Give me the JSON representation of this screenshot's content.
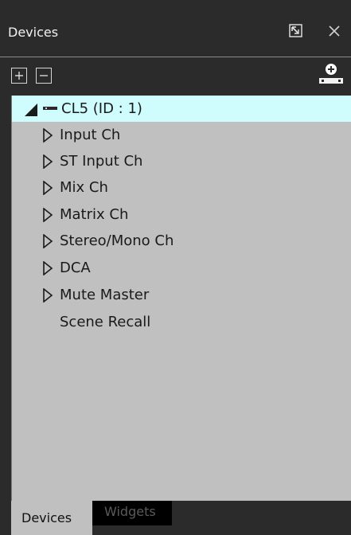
{
  "window": {
    "title": "Devices",
    "restore_icon": "restore-window-icon",
    "close_icon": "close-icon"
  },
  "toolbar": {
    "expand_all_icon": "plus-box-icon",
    "collapse_all_icon": "minus-box-icon",
    "add_device_icon": "add-device-icon"
  },
  "tree": {
    "root": {
      "label": "CL5 (ID : 1)",
      "expanded": true,
      "icon": "device-icon"
    },
    "children": [
      {
        "label": "Input Ch",
        "expandable": true
      },
      {
        "label": "ST Input Ch",
        "expandable": true
      },
      {
        "label": "Mix Ch",
        "expandable": true
      },
      {
        "label": "Matrix Ch",
        "expandable": true
      },
      {
        "label": "Stereo/Mono Ch",
        "expandable": true
      },
      {
        "label": "DCA",
        "expandable": true
      },
      {
        "label": "Mute Master",
        "expandable": true
      },
      {
        "label": "Scene Recall",
        "expandable": false
      }
    ]
  },
  "tabs": [
    {
      "label": "Devices",
      "active": true
    },
    {
      "label": "Widgets",
      "active": false
    }
  ],
  "colors": {
    "selection": "#cffcfd",
    "tree_background": "#c0c0c0",
    "chrome": "#2b2b2b"
  }
}
